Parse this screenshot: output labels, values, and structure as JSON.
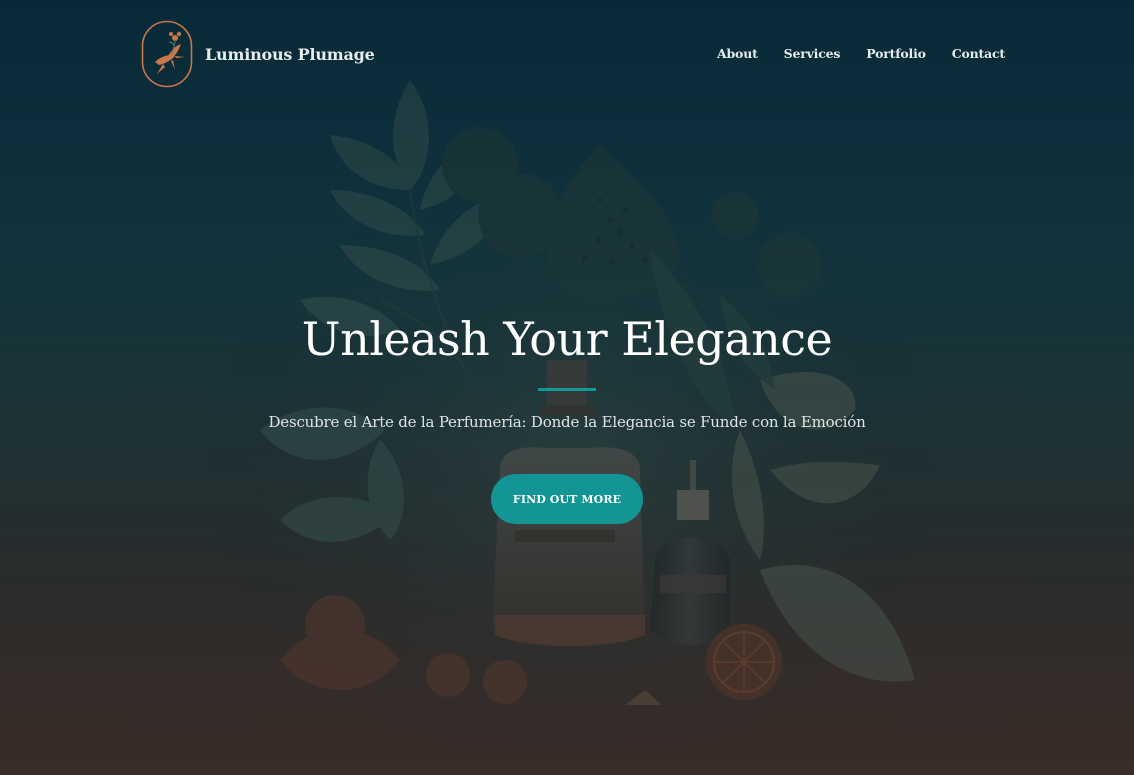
{
  "brand": {
    "name": "Luminous Plumage",
    "logo_icon": "hummingbird-icon",
    "logo_color": "#c9774a"
  },
  "nav": {
    "items": [
      {
        "label": "About"
      },
      {
        "label": "Services"
      },
      {
        "label": "Portfolio"
      },
      {
        "label": "Contact"
      }
    ]
  },
  "hero": {
    "title": "Unleash Your Elegance",
    "subtitle": "Descubre el Arte de la Perfumería: Donde la Elegancia se Funde con la Emoción",
    "cta_label": "FIND OUT MORE",
    "background_image": "perfume-bottles-botanical-illustration",
    "accent_color": "#139595"
  }
}
